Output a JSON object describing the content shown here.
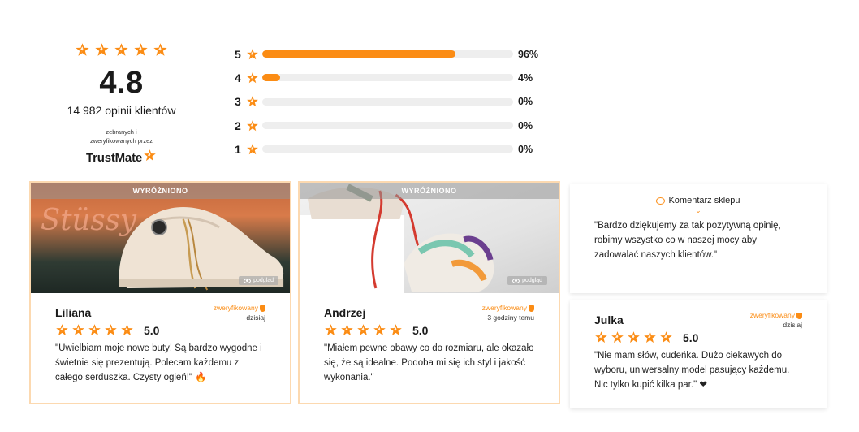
{
  "summary": {
    "rating": "4.8",
    "reviews_count": "14 982 opinii klientów",
    "collected_label": "zebranych i\nzweryfikowanych przez",
    "brand": "TrustMate"
  },
  "distribution": [
    {
      "level": "5",
      "percent_label": "96%",
      "fraction": 0.77
    },
    {
      "level": "4",
      "percent_label": "4%",
      "fraction": 0.07
    },
    {
      "level": "3",
      "percent_label": "0%",
      "fraction": 0
    },
    {
      "level": "2",
      "percent_label": "0%",
      "fraction": 0
    },
    {
      "level": "1",
      "percent_label": "0%",
      "fraction": 0
    }
  ],
  "reviews": [
    {
      "featured": "WYRÓŻNIONO",
      "preview": "podgląd",
      "name": "Liliana",
      "verified": "zweryfikowany",
      "when": "dzisiaj",
      "score": "5.0",
      "text": "\"Uwielbiam moje nowe buty! Są bardzo wygodne i świetnie się prezentują. Polecam każdemu z całego serduszka. Czysty ogień!\" 🔥"
    },
    {
      "featured": "WYRÓŻNIONO",
      "preview": "podgląd",
      "name": "Andrzej",
      "verified": "zweryfikowany",
      "when": "3 godziny temu",
      "score": "5.0",
      "text": "\"Miałem pewne obawy co do rozmiaru, ale okazało się, że są idealne. Podoba mi się ich styl i jakość wykonania.\""
    },
    {
      "name": "Julka",
      "verified": "zweryfikowany",
      "when": "dzisiaj",
      "score": "5.0",
      "text": "\"Nie mam słów, cudeńka. Dużo ciekawych do wyboru, uniwersalny model pasujący każdemu. Nic tylko kupić kilka par.\" ❤"
    }
  ],
  "shop_comment": {
    "title": "Komentarz sklepu",
    "text": "\"Bardzo dziękujemy za tak pozytywną opinię, robimy wszystko co w naszej mocy aby zadowalać naszych klientów.\""
  },
  "colors": {
    "accent": "#fb8c14",
    "track": "#eeeeee",
    "card_border": "#fcd9b0"
  },
  "icons": [
    "star-icon",
    "shield-icon",
    "eye-icon",
    "comment-bubble-icon",
    "chevron-down-icon"
  ]
}
